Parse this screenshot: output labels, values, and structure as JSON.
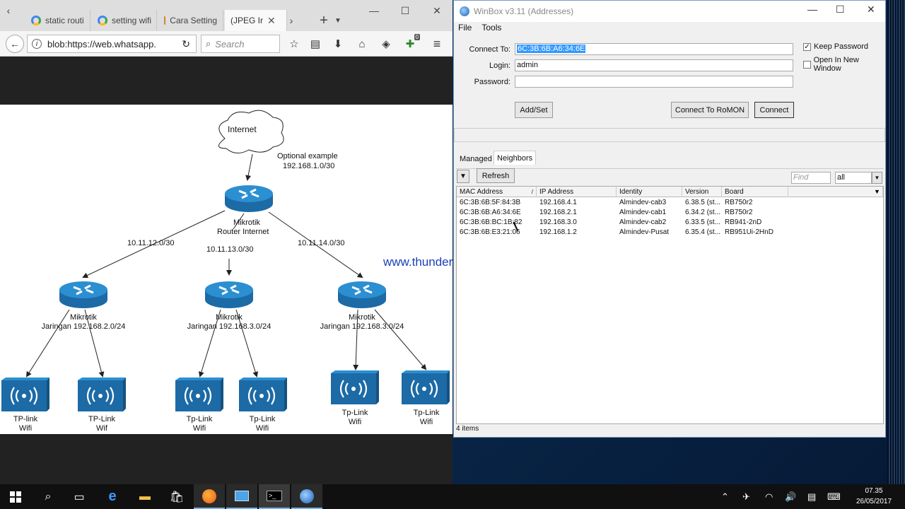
{
  "browser": {
    "tabs": [
      {
        "label": "static routi"
      },
      {
        "label": "setting wifi"
      },
      {
        "label": "Cara Setting"
      },
      {
        "label": "(JPEG Ir"
      }
    ],
    "url": "blob:https://web.whatsapp.",
    "search_placeholder": "Search",
    "pocket_badge": "0"
  },
  "diagram": {
    "internet": "Internet",
    "optional_line1": "Optional example",
    "optional_line2": "192.168.1.0/30",
    "core_line1": "Mikrotik",
    "core_line2": "Router Internet",
    "link_left": "10.11.12.0/30",
    "link_mid": "10.11.13.0/30",
    "link_right": "10.11.14.0/30",
    "routers": [
      {
        "line1": "Mikrotik",
        "line2": "Jaringan 192.168.2.0/24"
      },
      {
        "line1": "Mikrotik",
        "line2": "Jaringan 192.168.3.0/24"
      },
      {
        "line1": "Mikrotik",
        "line2": "Jaringan 192.168.3.0/24"
      }
    ],
    "aps": [
      {
        "line1": "TP-link",
        "line2": "Wifi"
      },
      {
        "line1": "TP-Link",
        "line2": "Wif"
      },
      {
        "line1": "Tp-Link",
        "line2": "Wifi"
      },
      {
        "line1": "Tp-Link",
        "line2": "Wifi"
      },
      {
        "line1": "Tp-Link",
        "line2": "Wifi"
      },
      {
        "line1": "Tp-Link",
        "line2": "Wifi"
      }
    ],
    "watermark": "www.thundershare.net"
  },
  "winbox": {
    "title": "WinBox v3.11 (Addresses)",
    "menu": [
      "File",
      "Tools"
    ],
    "connect_to_label": "Connect To:",
    "connect_to_value": "6C:3B:6B:A6:34:6E",
    "login_label": "Login:",
    "login_value": "admin",
    "password_label": "Password:",
    "keep_password": "Keep Password",
    "open_new_window": "Open In New Window",
    "add_set": "Add/Set",
    "connect_romon": "Connect To RoMON",
    "connect": "Connect",
    "tab_managed": "Managed",
    "tab_neighbors": "Neighbors",
    "refresh": "Refresh",
    "find_placeholder": "Find",
    "filter_value": "all",
    "columns": [
      "MAC Address",
      "IP Address",
      "Identity",
      "Version",
      "Board"
    ],
    "rows": [
      [
        "6C:3B:6B:5F:84:3B",
        "192.168.4.1",
        "Almindev-cab3",
        "6.38.5 (st...",
        "RB750r2"
      ],
      [
        "6C:3B:6B:A6:34:6E",
        "192.168.2.1",
        "Almindev-cab1",
        "6.34.2 (st...",
        "RB750r2"
      ],
      [
        "6C:3B:6B:BC:1B:82",
        "192.168.3.0",
        "Almindev-cab2",
        "6.33.5 (st...",
        "RB941-2nD"
      ],
      [
        "6C:3B:6B:E3:21:06",
        "192.168.1.2",
        "Almindev-Pusat",
        "6.35.4 (st...",
        "RB951Ui-2HnD"
      ]
    ],
    "item_count": "4 items"
  },
  "taskbar": {
    "time": "07.35",
    "date": "26/05/2017"
  }
}
